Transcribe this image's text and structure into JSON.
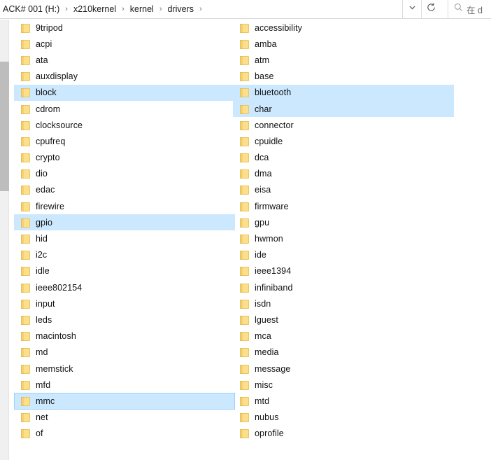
{
  "addressbar": {
    "crumbs": [
      "ACK# 001 (H:)",
      "x210kernel",
      "kernel",
      "drivers"
    ],
    "separator": "›",
    "history_icon": "chevron-down-icon",
    "refresh_icon": "refresh-icon",
    "search": {
      "icon": "search-icon",
      "placeholder": "在 d"
    }
  },
  "colors": {
    "selection": "#cce8ff",
    "folder": "#fcdf8a",
    "text": "#111111"
  },
  "filelist": {
    "left_column": [
      {
        "name": "9tripod",
        "state": "normal"
      },
      {
        "name": "acpi",
        "state": "normal"
      },
      {
        "name": "ata",
        "state": "normal"
      },
      {
        "name": "auxdisplay",
        "state": "normal"
      },
      {
        "name": "block",
        "state": "selected"
      },
      {
        "name": "cdrom",
        "state": "normal"
      },
      {
        "name": "clocksource",
        "state": "normal"
      },
      {
        "name": "cpufreq",
        "state": "normal"
      },
      {
        "name": "crypto",
        "state": "normal"
      },
      {
        "name": "dio",
        "state": "normal"
      },
      {
        "name": "edac",
        "state": "normal"
      },
      {
        "name": "firewire",
        "state": "normal"
      },
      {
        "name": "gpio",
        "state": "selected"
      },
      {
        "name": "hid",
        "state": "normal"
      },
      {
        "name": "i2c",
        "state": "normal"
      },
      {
        "name": "idle",
        "state": "normal"
      },
      {
        "name": "ieee802154",
        "state": "normal"
      },
      {
        "name": "input",
        "state": "normal"
      },
      {
        "name": "leds",
        "state": "normal"
      },
      {
        "name": "macintosh",
        "state": "normal"
      },
      {
        "name": "md",
        "state": "normal"
      },
      {
        "name": "memstick",
        "state": "normal"
      },
      {
        "name": "mfd",
        "state": "normal"
      },
      {
        "name": "mmc",
        "state": "focused"
      },
      {
        "name": "net",
        "state": "normal"
      },
      {
        "name": "of",
        "state": "normal"
      }
    ],
    "right_column": [
      {
        "name": "accessibility",
        "state": "normal"
      },
      {
        "name": "amba",
        "state": "normal"
      },
      {
        "name": "atm",
        "state": "normal"
      },
      {
        "name": "base",
        "state": "normal"
      },
      {
        "name": "bluetooth",
        "state": "selected"
      },
      {
        "name": "char",
        "state": "selected"
      },
      {
        "name": "connector",
        "state": "normal"
      },
      {
        "name": "cpuidle",
        "state": "normal"
      },
      {
        "name": "dca",
        "state": "normal"
      },
      {
        "name": "dma",
        "state": "normal"
      },
      {
        "name": "eisa",
        "state": "normal"
      },
      {
        "name": "firmware",
        "state": "normal"
      },
      {
        "name": "gpu",
        "state": "normal"
      },
      {
        "name": "hwmon",
        "state": "normal"
      },
      {
        "name": "ide",
        "state": "normal"
      },
      {
        "name": "ieee1394",
        "state": "normal"
      },
      {
        "name": "infiniband",
        "state": "normal"
      },
      {
        "name": "isdn",
        "state": "normal"
      },
      {
        "name": "lguest",
        "state": "normal"
      },
      {
        "name": "mca",
        "state": "normal"
      },
      {
        "name": "media",
        "state": "normal"
      },
      {
        "name": "message",
        "state": "normal"
      },
      {
        "name": "misc",
        "state": "normal"
      },
      {
        "name": "mtd",
        "state": "normal"
      },
      {
        "name": "nubus",
        "state": "normal"
      },
      {
        "name": "oprofile",
        "state": "normal"
      }
    ]
  }
}
